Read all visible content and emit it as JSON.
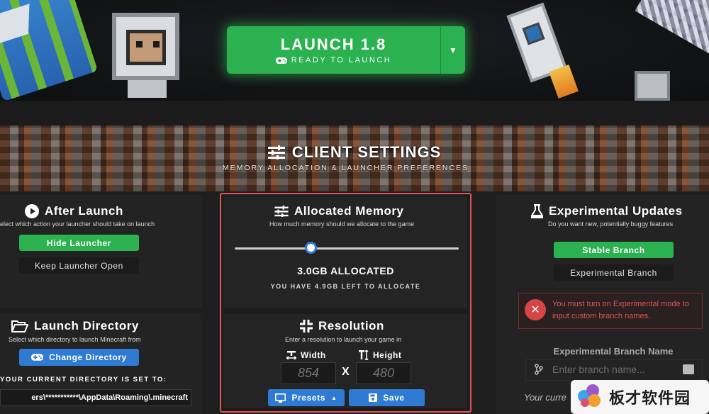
{
  "launch": {
    "title": "LAUNCH 1.8",
    "subtitle": "READY TO LAUNCH"
  },
  "header": {
    "title": "CLIENT SETTINGS",
    "subtitle": "MEMORY ALLOCATION & LAUNCHER PREFERENCES"
  },
  "after_launch": {
    "title": "After Launch",
    "description": "elect which action your launcher should take on launch",
    "options": [
      "Hide Launcher",
      "Keep Launcher Open"
    ],
    "selected": "Hide Launcher"
  },
  "launch_directory": {
    "title": "Launch Directory",
    "description": "Select which directory to launch Minecraft from",
    "button": "Change Directory",
    "current_label": "YOUR CURRENT DIRECTORY IS SET TO:",
    "current_value": "ers\\***********\\AppData\\Roaming\\.minecraft"
  },
  "memory": {
    "title": "Allocated Memory",
    "description": "How much memory should we allocate to the game",
    "allocated": "3.0GB ALLOCATED",
    "remaining": "YOU HAVE 4.9GB LEFT TO ALLOCATE",
    "slider_fraction": 0.34
  },
  "resolution": {
    "title": "Resolution",
    "description": "Enter a resolution to launch your game in",
    "width_label": "Width",
    "height_label": "Height",
    "width_placeholder": "854",
    "height_placeholder": "480",
    "separator": "X",
    "presets_button": "Presets",
    "save_button": "Save"
  },
  "experimental": {
    "title": "Experimental Updates",
    "description": "Do you want new, potentially buggy features",
    "options": [
      "Stable Branch",
      "Experimental Branch"
    ],
    "selected": "Stable Branch",
    "error": "You must turn on Experimental mode to input custom branch names.",
    "branch_name_label": "Experimental Branch Name",
    "branch_placeholder": "Enter branch name...",
    "current_text": "Your curre"
  },
  "watermark": {
    "text": "板才软件园"
  },
  "colors": {
    "green": "#2bb150",
    "blue": "#2f7bd4",
    "error": "#e05555",
    "panel": "#232323"
  }
}
